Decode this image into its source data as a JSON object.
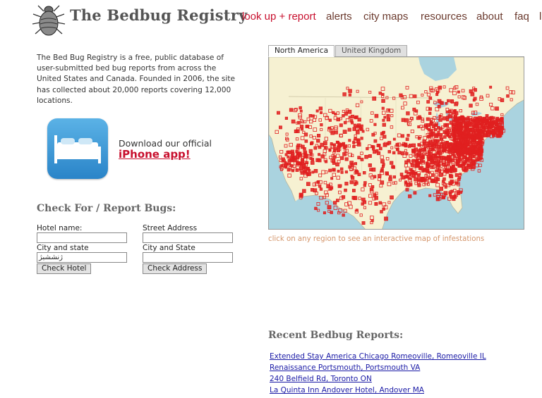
{
  "header": {
    "site_title": "The Bedbug Registry",
    "logo_icon": "bedbug-icon",
    "nav": [
      "look up + report",
      "alerts",
      "city maps",
      "resources",
      "about",
      "faq",
      "l"
    ]
  },
  "intro": {
    "text": "The Bed Bug Registry is a free, public database of user-submitted bed bug reports from across the United States and Canada. Founded in 2006, the site has collected about 20,000 reports covering 12,000 locations."
  },
  "app_promo": {
    "icon": "bed-app-icon",
    "download_text": "Download our official",
    "link_text": "iPhone app!"
  },
  "form": {
    "title": "Check For / Report Bugs:",
    "hotel_name_label": "Hotel name:",
    "hotel_name_value": "",
    "hotel_city_label": "City and state",
    "hotel_city_value": "ژنششبژ",
    "check_hotel_button": "Check Hotel",
    "street_label": "Street Address",
    "street_value": "",
    "address_city_label": "City and State",
    "address_city_value": "",
    "check_address_button": "Check Address"
  },
  "map": {
    "tabs": [
      "North America",
      "United Kingdom"
    ],
    "active_tab": "North America",
    "caption": "click on any region to see an interactive map of infestations",
    "colors": {
      "land": "#f6f1d2",
      "water": "#aad3df",
      "marker": "#e02020"
    }
  },
  "recent": {
    "title": "Recent Bedbug Reports:",
    "reports": [
      "Extended Stay America Chicago Romeoville, Romeoville IL",
      "Renaissance Portsmouth, Portsmouth VA",
      "240 Belfield Rd, Toronto ON",
      "La Quinta Inn Andover Hotel, Andover MA"
    ]
  }
}
